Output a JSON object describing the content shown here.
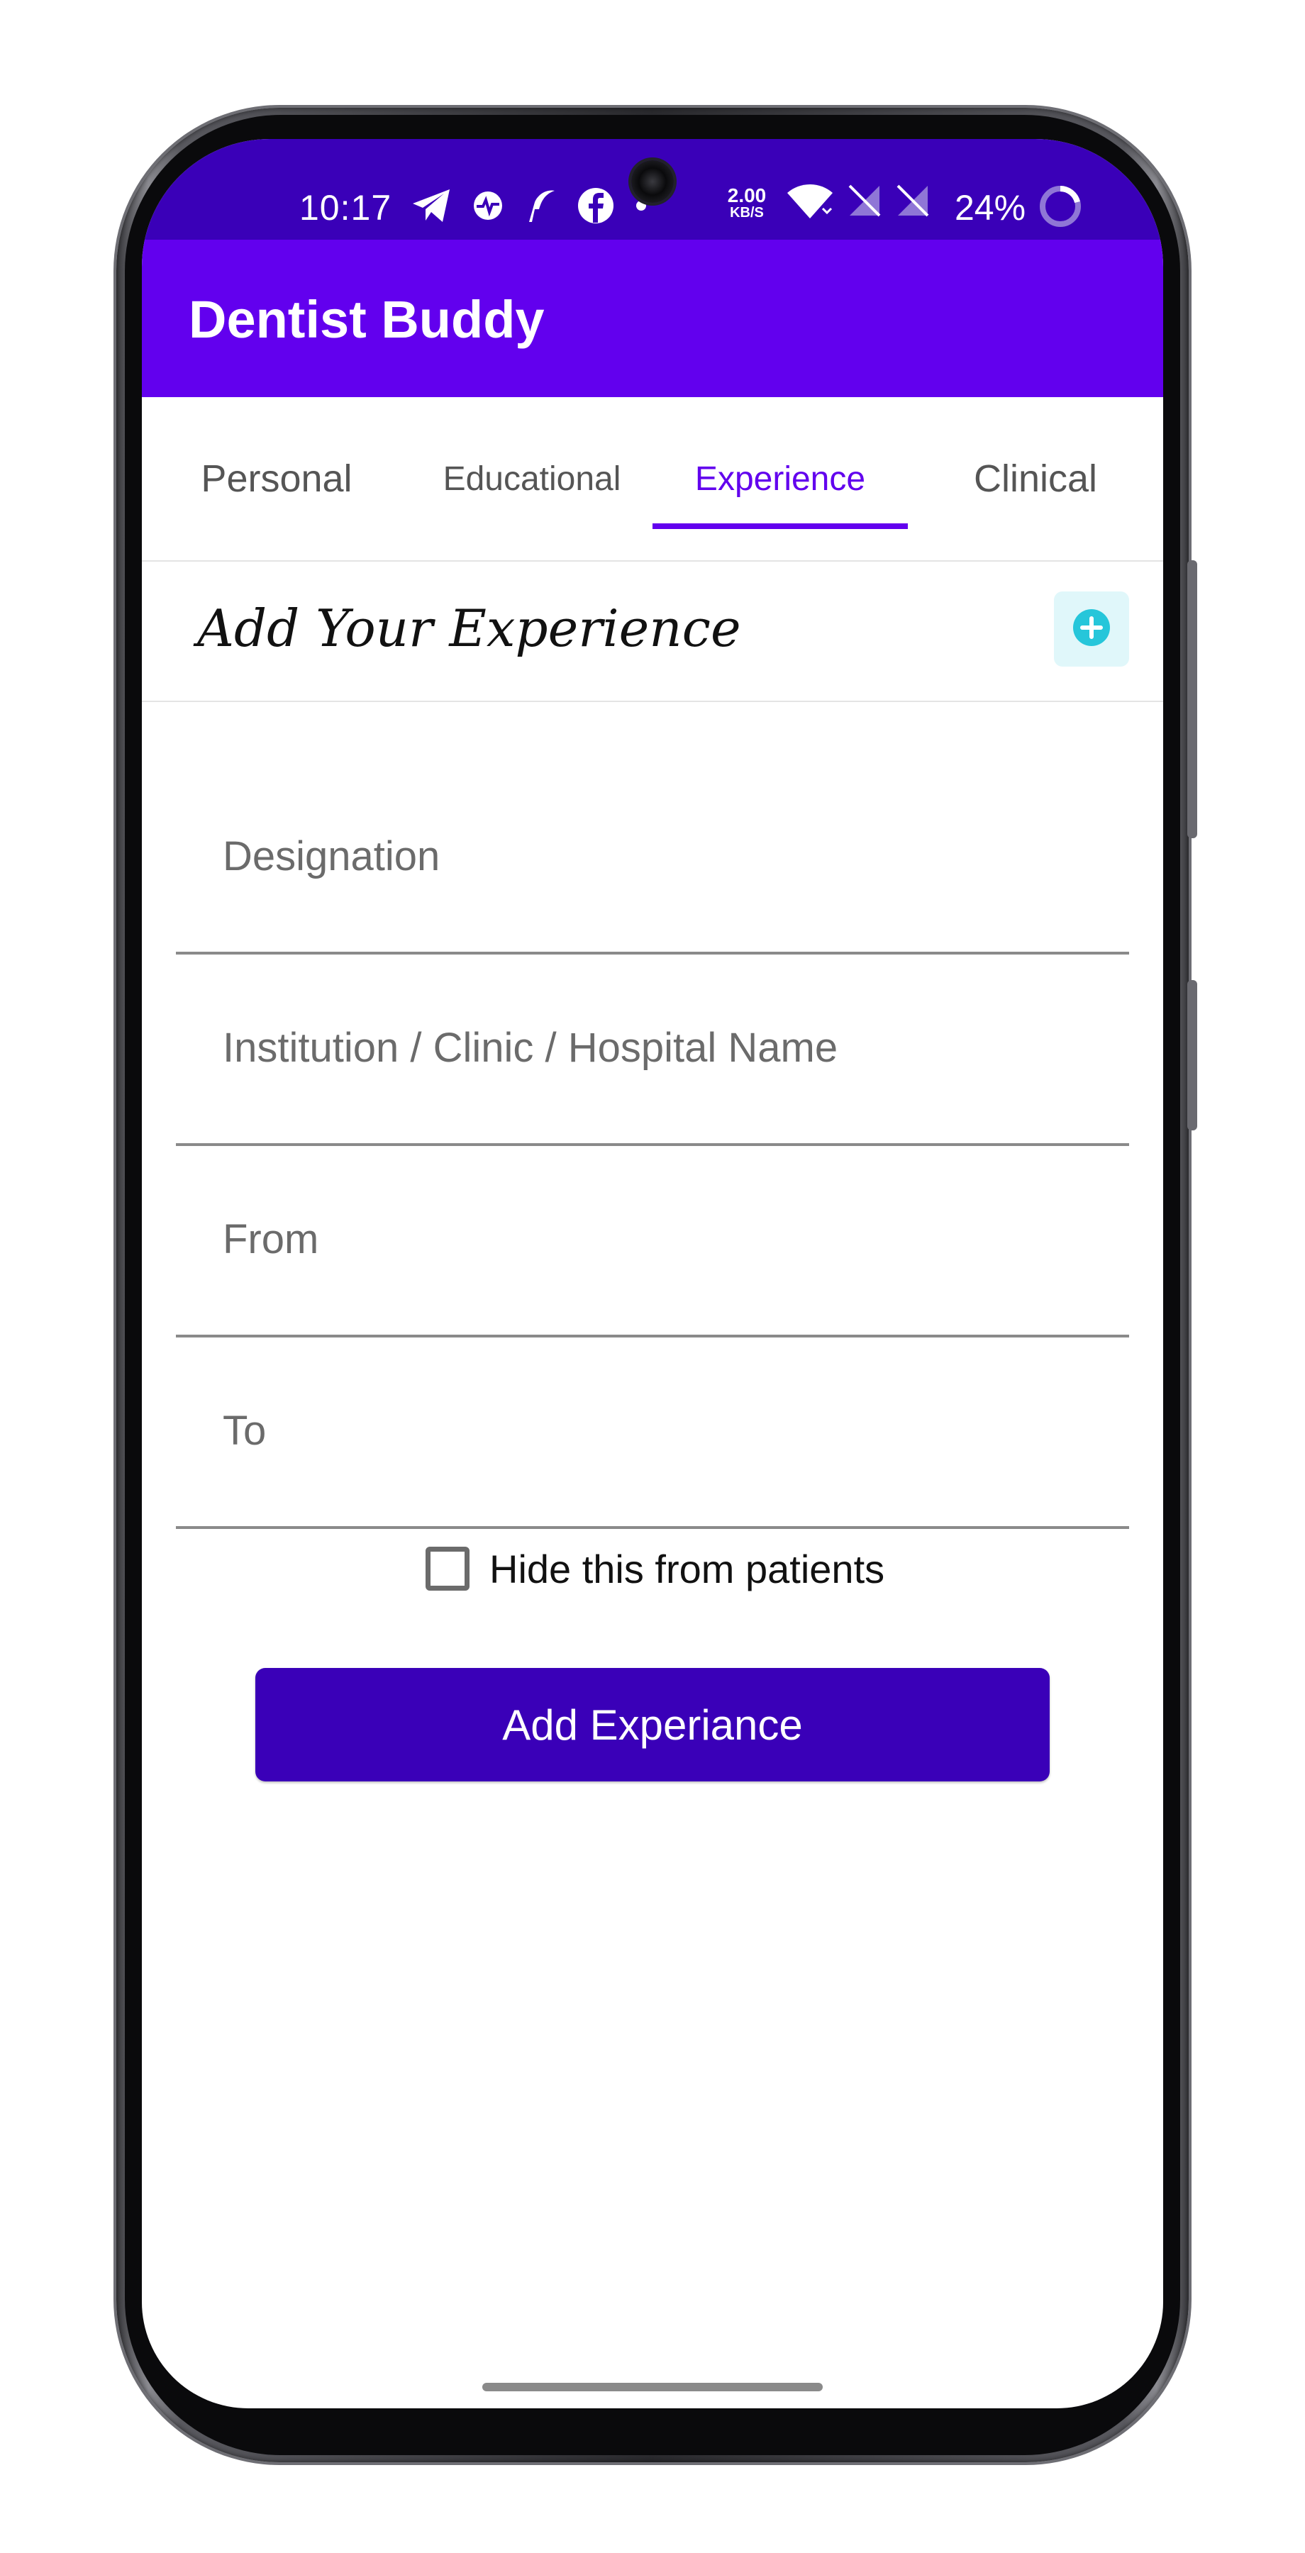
{
  "status_bar": {
    "time": "10:17",
    "net_speed_value": "2.00",
    "net_speed_unit": "KB/S",
    "battery": "24%",
    "icons": [
      "telegram-icon",
      "activity-icon",
      "feather-icon",
      "facebook-icon",
      "dot-icon",
      "wifi-icon",
      "no-sim-icon",
      "no-sim-icon",
      "battery-ring-icon"
    ]
  },
  "app_bar": {
    "title": "Dentist Buddy",
    "color": "#6200ee"
  },
  "tabs": [
    {
      "label": "Personal",
      "active": false
    },
    {
      "label": "Educational",
      "active": false
    },
    {
      "label": "Experience",
      "active": true
    },
    {
      "label": "Clinical",
      "active": false
    }
  ],
  "section": {
    "title": "Add Your Experience",
    "add_icon": "plus-circle-icon",
    "add_icon_color": "#26c6da"
  },
  "form": {
    "fields": [
      {
        "placeholder": "Designation",
        "value": ""
      },
      {
        "placeholder": "Institution / Clinic / Hospital Name",
        "value": ""
      },
      {
        "placeholder": "From",
        "value": ""
      },
      {
        "placeholder": "To",
        "value": ""
      }
    ],
    "checkbox_label": "Hide this from patients",
    "checkbox_checked": false,
    "submit_label": "Add Experiance",
    "submit_color": "#3a00b8"
  }
}
